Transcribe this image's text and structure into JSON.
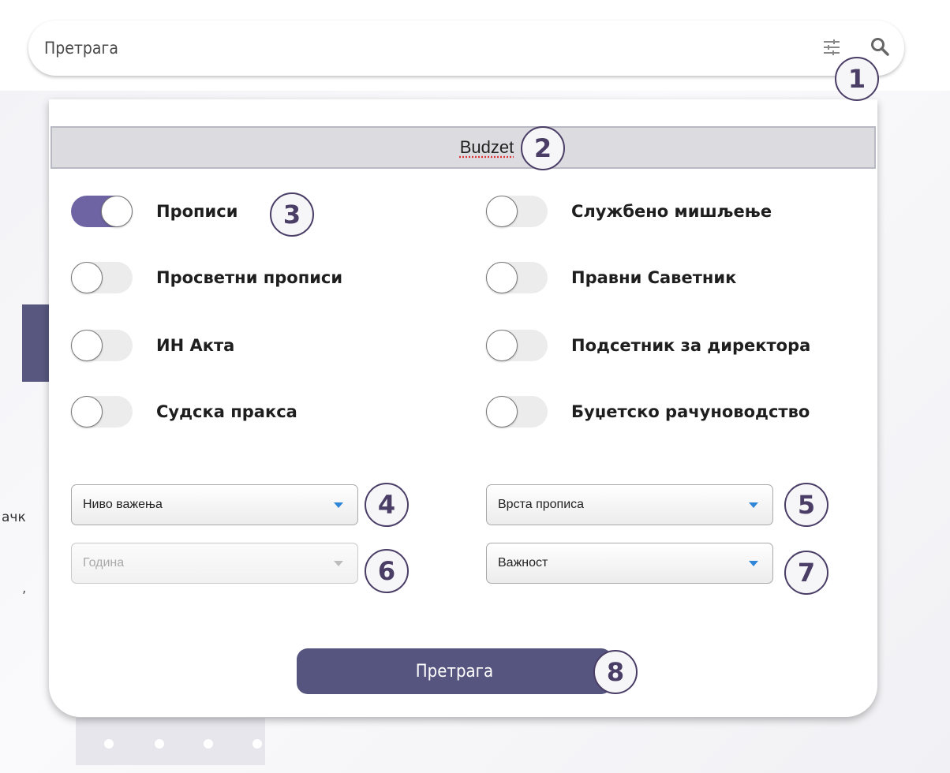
{
  "background": {
    "text_fragment_1": "ачк",
    "text_fragment_2": ","
  },
  "search": {
    "placeholder": "Претрага",
    "filter_icon": "sliders-icon",
    "search_icon": "magnifier-icon"
  },
  "panel": {
    "title": "Budzet",
    "toggles": [
      {
        "label": "Прописи",
        "on": true
      },
      {
        "label": "Службено мишљење",
        "on": false
      },
      {
        "label": "Просветни прописи",
        "on": false
      },
      {
        "label": "Правни Саветник",
        "on": false
      },
      {
        "label": "ИН Акта",
        "on": false
      },
      {
        "label": "Подсетник за директора",
        "on": false
      },
      {
        "label": "Судска пракса",
        "on": false
      },
      {
        "label": "Буџетско рачуноводство",
        "on": false
      }
    ],
    "selects": {
      "validity_level": "Ниво важења",
      "regulation_type": "Врста прописа",
      "year": "Година",
      "importance": "Важност"
    },
    "search_button": "Претрага"
  },
  "markers": [
    "1",
    "2",
    "3",
    "4",
    "5",
    "6",
    "7",
    "8"
  ],
  "colors": {
    "accent": "#6e63a3",
    "button": "#56557f",
    "marker": "#4a3d66",
    "arrow": "#2f86d6"
  }
}
